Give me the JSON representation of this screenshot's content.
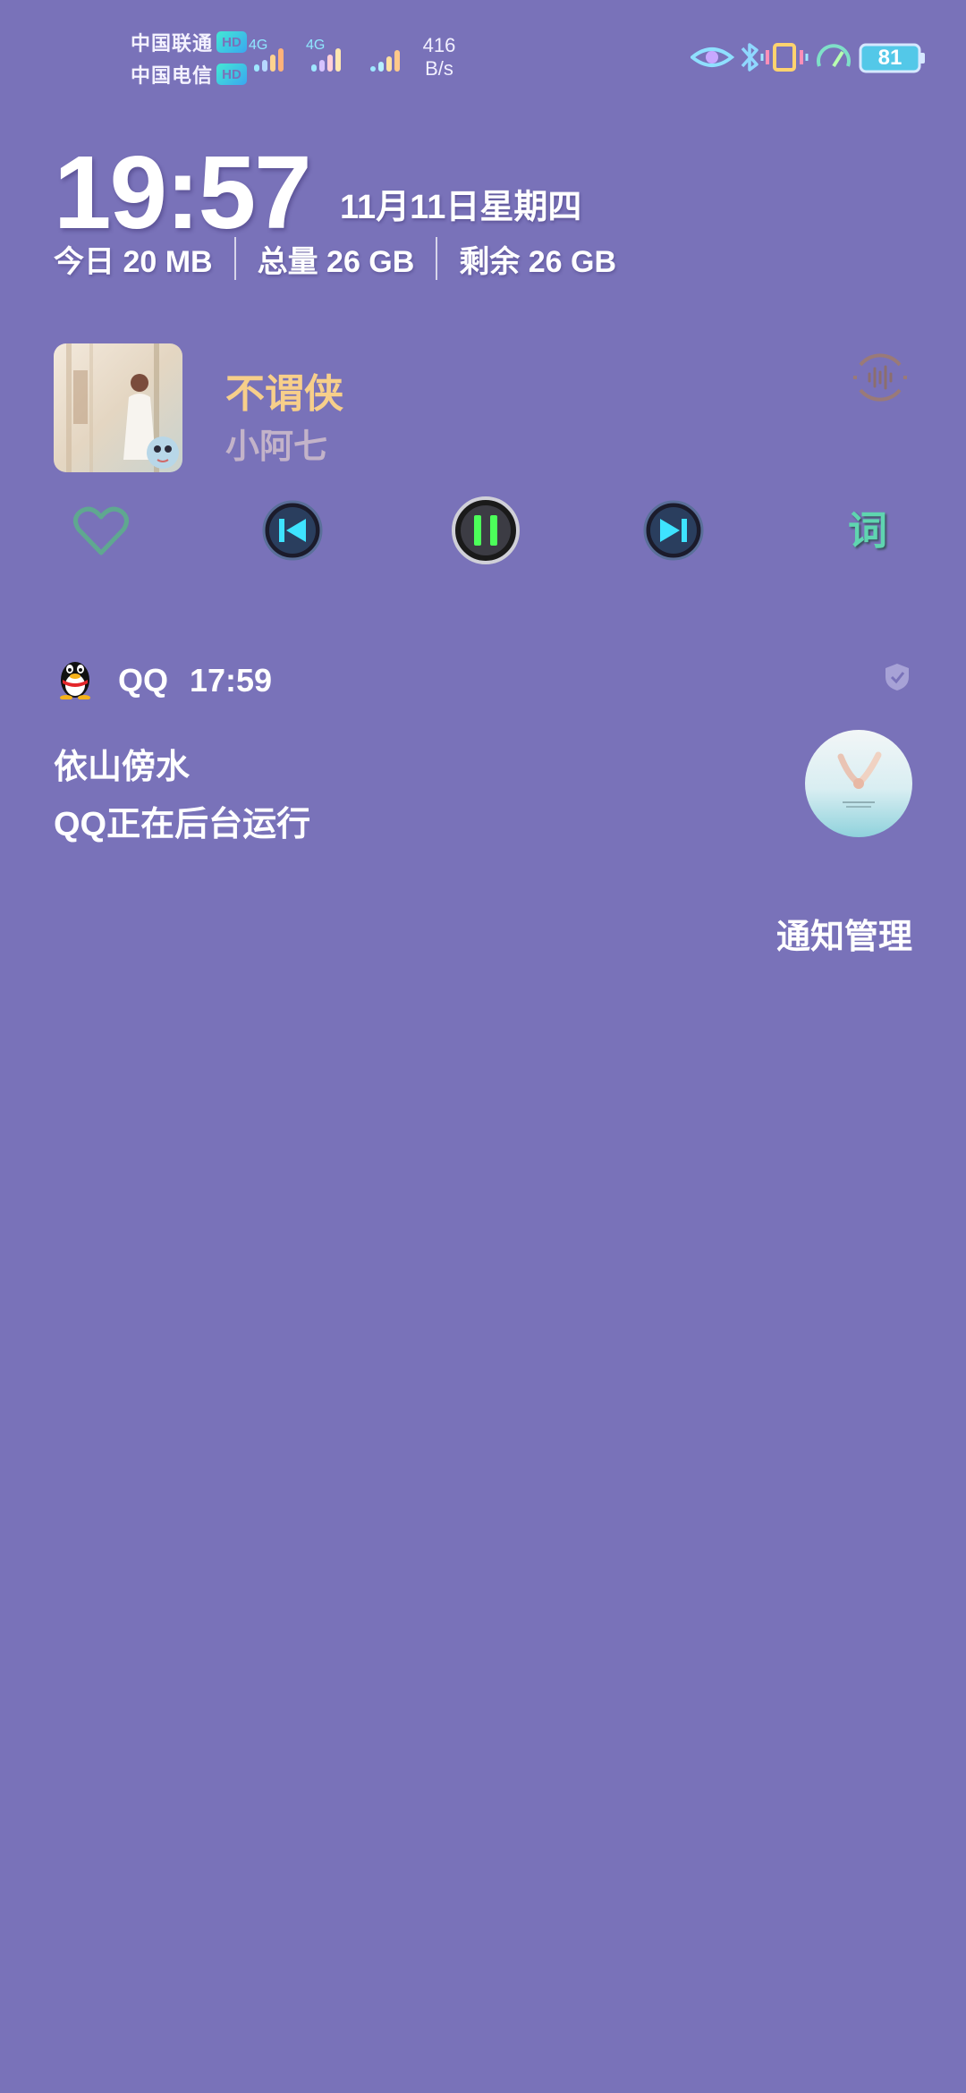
{
  "status_bar": {
    "carriers": [
      {
        "name": "中国联通",
        "badge": "HD",
        "net": "4G"
      },
      {
        "name": "中国电信",
        "badge": "HD",
        "net": "4G"
      }
    ],
    "net_speed_value": "416",
    "net_speed_unit": "B/s",
    "battery": "81",
    "icons": [
      "eye-icon",
      "bluetooth-icon",
      "vibrate-icon",
      "speedometer-icon",
      "battery-icon"
    ]
  },
  "clock": {
    "time": "19:57",
    "date": "11月11日星期四"
  },
  "data_usage": {
    "today": "今日 20 MB",
    "total": "总量 26 GB",
    "remaining": "剩余 26 GB"
  },
  "music": {
    "title": "不谓侠",
    "artist": "小阿七",
    "lyrics_label": "词",
    "state": "playing",
    "accent_title": "#f7cf8a",
    "accent_artist": "#c3b3c9"
  },
  "notification": {
    "app": "QQ",
    "time": "17:59",
    "title": "依山傍水",
    "body": "QQ正在后台运行"
  },
  "manage_label": "通知管理",
  "colors": {
    "background": "#7972b9"
  }
}
